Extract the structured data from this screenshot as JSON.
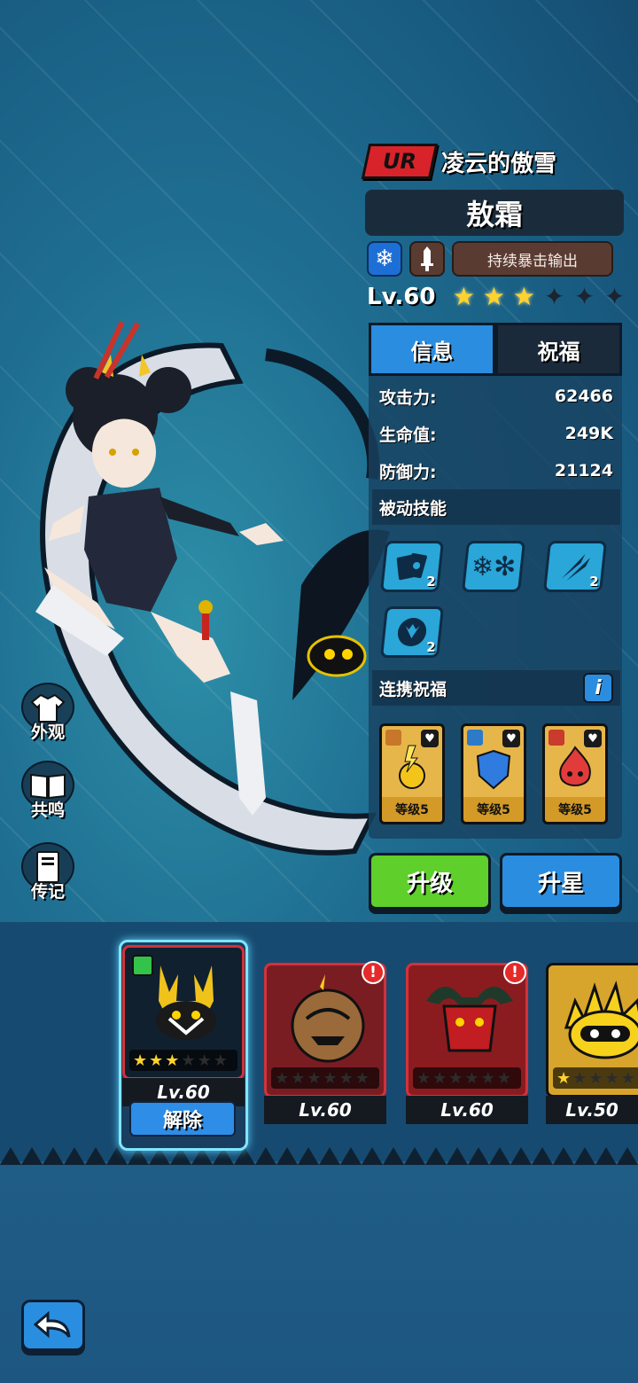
{
  "hero": {
    "rarity": "UR",
    "title": "凌云的傲雪",
    "name": "敖霜",
    "element_icon": "snowflake-icon",
    "role_icon": "sword-icon",
    "role_tag": "持续暴击输出",
    "level": "Lv.60",
    "stars_total": 6,
    "stars_on": 3
  },
  "tabs": [
    {
      "label": "信息",
      "active": true
    },
    {
      "label": "祝福",
      "active": false
    }
  ],
  "stats": [
    {
      "label": "攻击力:",
      "value": "62466"
    },
    {
      "label": "生命值:",
      "value": "249K"
    },
    {
      "label": "防御力:",
      "value": "21124"
    }
  ],
  "passive": {
    "title": "被动技能",
    "skills": [
      {
        "icon": "cards-icon",
        "count": "2"
      },
      {
        "icon": "snowflakes-icon",
        "count": ""
      },
      {
        "icon": "claw-slash-icon",
        "count": "2"
      },
      {
        "icon": "dragon-head-icon",
        "count": "2"
      }
    ]
  },
  "bond": {
    "title": "连携祝福",
    "info_label": "i",
    "cards": [
      {
        "icon": "lightning-orb-icon",
        "level": "等级5"
      },
      {
        "icon": "blue-shield-icon",
        "level": "等级5"
      },
      {
        "icon": "red-spirit-icon",
        "level": "等级5"
      }
    ]
  },
  "actions": {
    "upgrade": "升级",
    "star_up": "升星"
  },
  "side": [
    {
      "icon": "shirt-icon",
      "label": "外观"
    },
    {
      "icon": "book-icon",
      "label": "共鸣"
    },
    {
      "icon": "journal-icon",
      "label": "传记"
    }
  ],
  "roster": [
    {
      "name": "deer-spirit",
      "level": "Lv.60",
      "stars_on": 3,
      "selected": true,
      "action": "解除"
    },
    {
      "name": "pumpkin-beast",
      "level": "Lv.60",
      "stars_on": 0,
      "alert": "!"
    },
    {
      "name": "horned-demon",
      "level": "Lv.60",
      "stars_on": 0,
      "alert": "!"
    },
    {
      "name": "spiky-critter",
      "level": "Lv.50",
      "stars_on": 1
    }
  ],
  "colors": {
    "accent_blue": "#2b8de0",
    "accent_green": "#5ecf2b",
    "rarity_red": "#d8232a",
    "star_gold": "#ffd22e"
  }
}
